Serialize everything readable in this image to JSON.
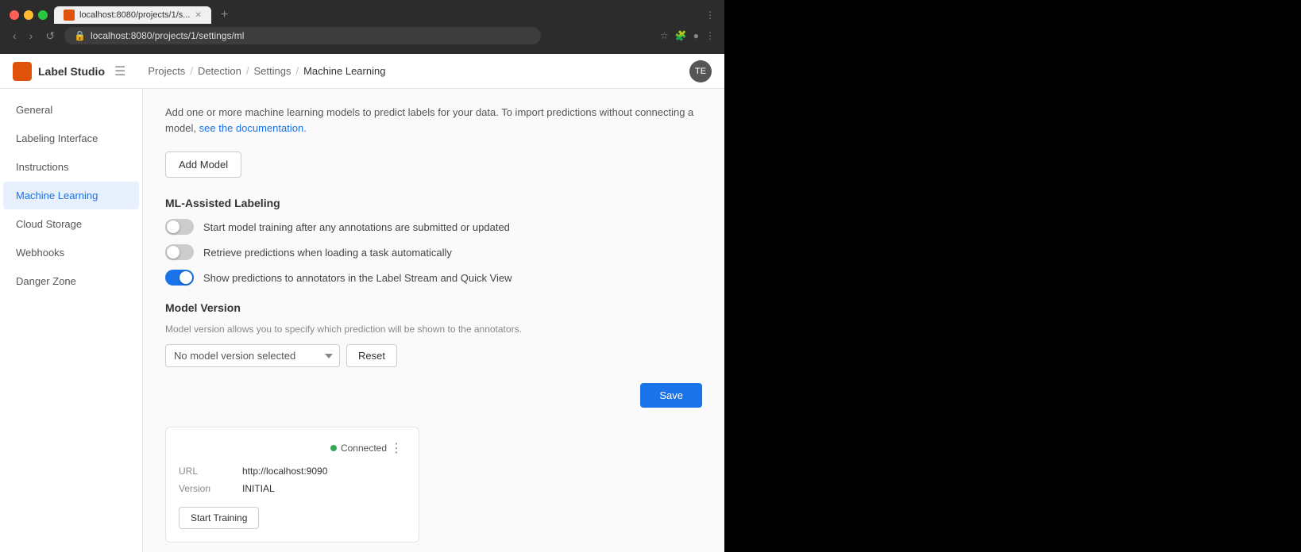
{
  "browser": {
    "tab_title": "localhost:8080/projects/1/s...",
    "url": "localhost:8080/projects/1/settings/ml",
    "new_tab_label": "+",
    "nav": {
      "back": "‹",
      "forward": "›",
      "refresh": "↺"
    }
  },
  "app": {
    "logo_text": "Label Studio",
    "avatar": "TE"
  },
  "breadcrumb": {
    "items": [
      "Projects",
      "Detection",
      "Settings",
      "Machine Learning"
    ],
    "separators": [
      "/",
      "/",
      "/"
    ]
  },
  "sidebar": {
    "items": [
      {
        "id": "general",
        "label": "General"
      },
      {
        "id": "labeling-interface",
        "label": "Labeling Interface"
      },
      {
        "id": "instructions",
        "label": "Instructions"
      },
      {
        "id": "machine-learning",
        "label": "Machine Learning",
        "active": true
      },
      {
        "id": "cloud-storage",
        "label": "Cloud Storage"
      },
      {
        "id": "webhooks",
        "label": "Webhooks"
      },
      {
        "id": "danger-zone",
        "label": "Danger Zone"
      }
    ]
  },
  "content": {
    "intro_text": "Add one or more machine learning models to predict labels for your data. To import predictions without connecting a model,",
    "intro_link": "see the documentation.",
    "add_model_btn": "Add Model",
    "ml_assisted_section": "ML-Assisted Labeling",
    "toggles": [
      {
        "id": "train-toggle",
        "label": "Start model training after any annotations are submitted or updated",
        "on": false
      },
      {
        "id": "retrieve-toggle",
        "label": "Retrieve predictions when loading a task automatically",
        "on": false
      },
      {
        "id": "show-toggle",
        "label": "Show predictions to annotators in the Label Stream and Quick View",
        "on": true
      }
    ],
    "model_version": {
      "title": "Model Version",
      "description": "Model version allows you to specify which prediction will be shown to the annotators.",
      "select_value": "No model version selected",
      "reset_btn": "Reset"
    },
    "save_btn": "Save",
    "model_card": {
      "connected_label": "Connected",
      "kebab": "⋮",
      "url_label": "URL",
      "url_value": "http://localhost:9090",
      "version_label": "Version",
      "version_value": "INITIAL",
      "start_training_btn": "Start Training"
    }
  }
}
